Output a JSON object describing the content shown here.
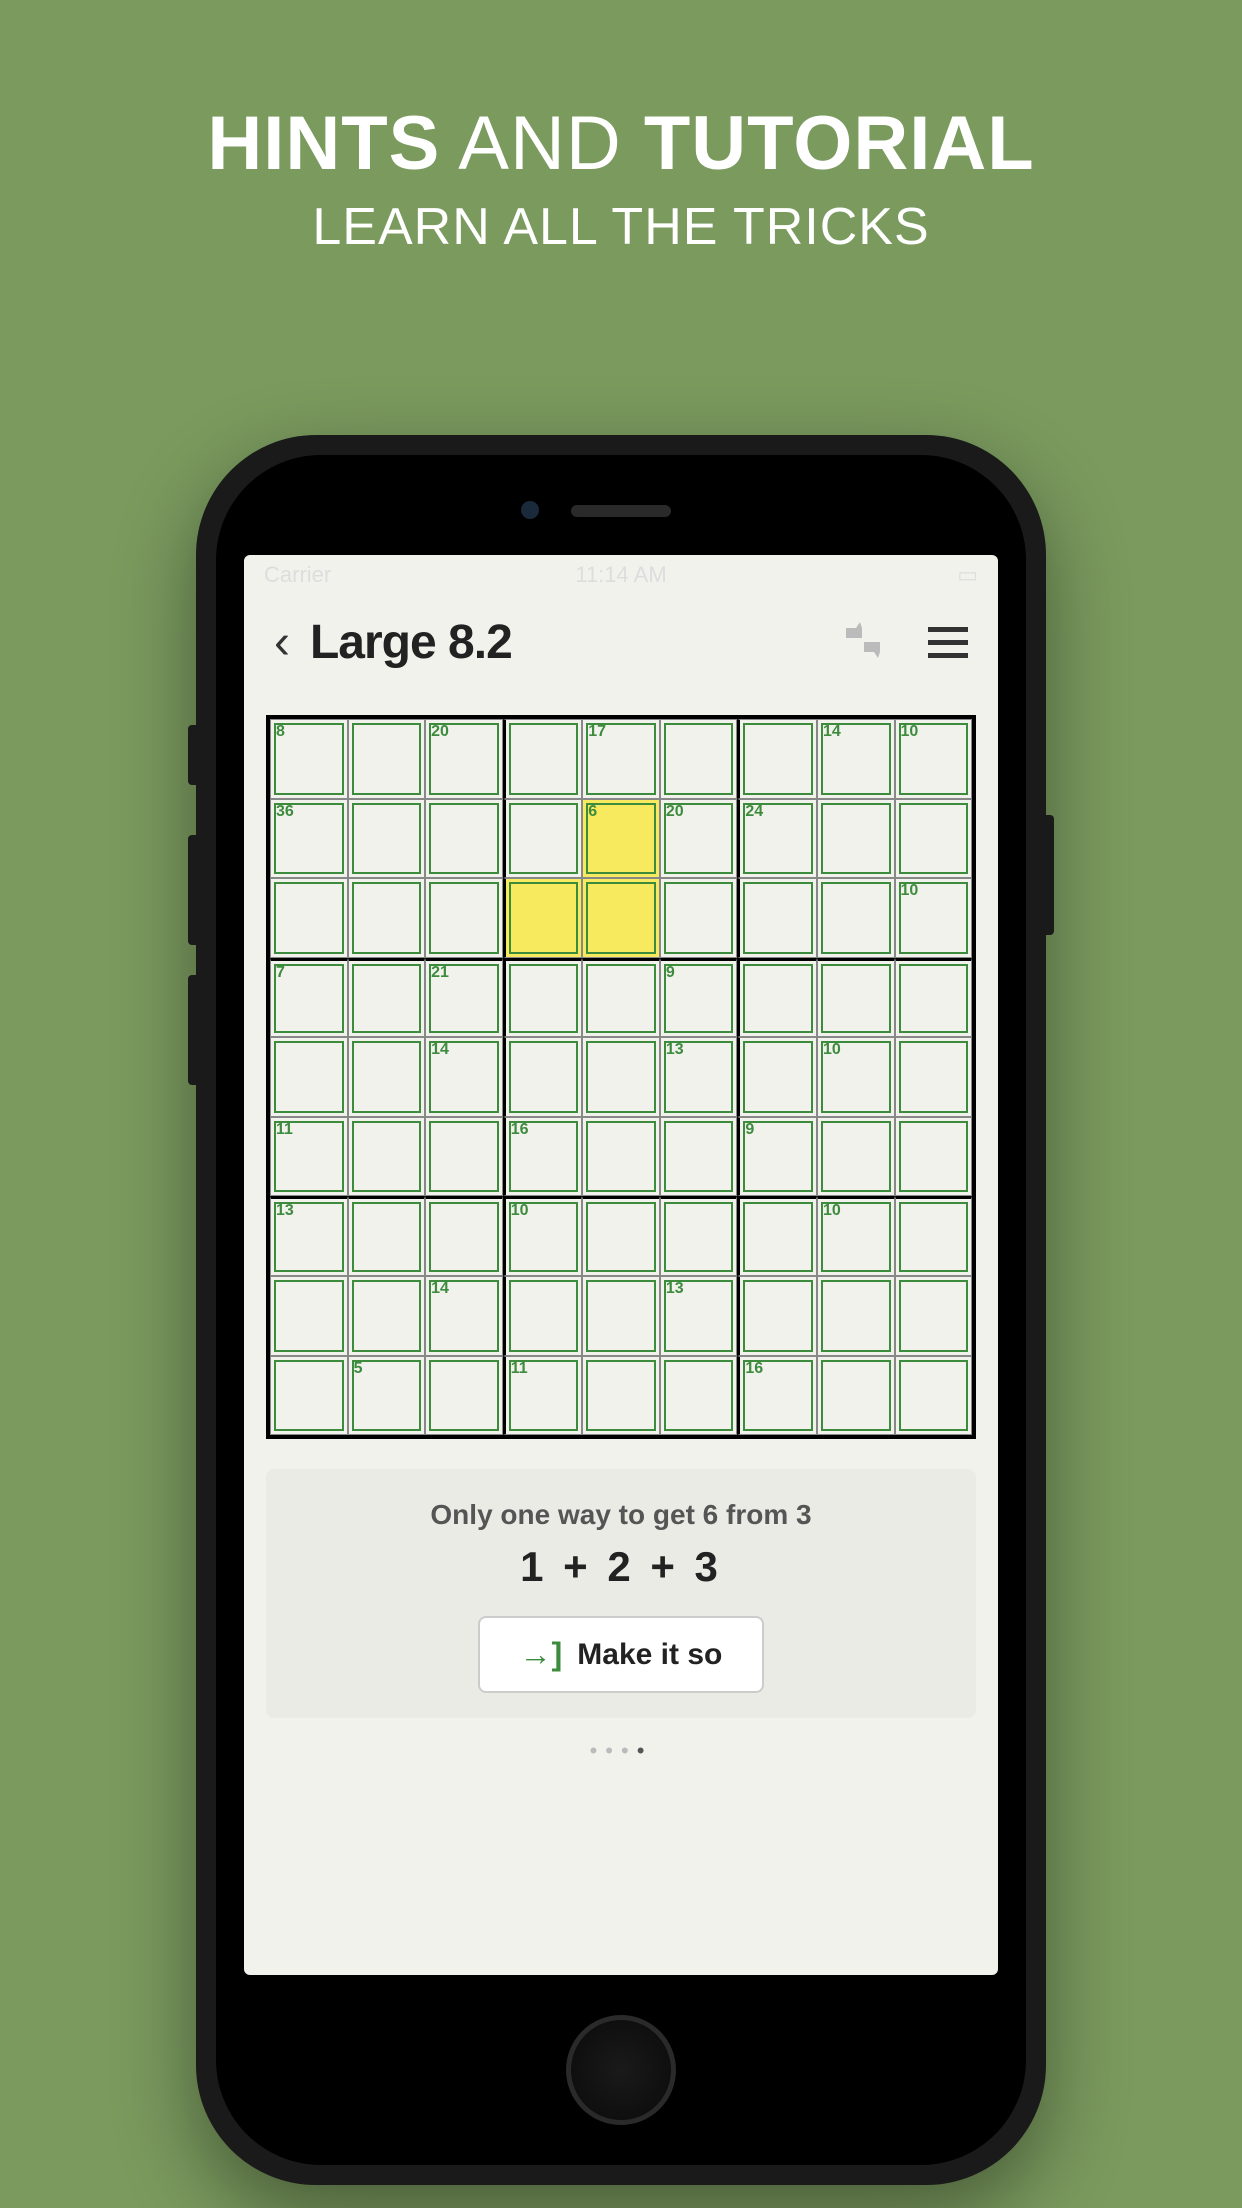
{
  "promo": {
    "title_b1": "HINTS",
    "title_mid": " AND ",
    "title_b2": "TUTORIAL",
    "subtitle": "LEARN ALL THE TRICKS"
  },
  "status": {
    "carrier": "Carrier",
    "time": "11:14 AM"
  },
  "nav": {
    "title": "Large 8.2"
  },
  "cages": {
    "r0c0": "8",
    "r0c2": "20",
    "r0c4": "17",
    "r0c7": "14",
    "r0c8": "10",
    "r1c0": "36",
    "r1c4": "6",
    "r1c5": "20",
    "r1c6": "24",
    "r2c8": "10",
    "r3c0": "7",
    "r3c2": "21",
    "r3c5": "9",
    "r4c2": "14",
    "r4c5": "13",
    "r4c7": "10",
    "r5c0": "11",
    "r5c3": "16",
    "r5c6": "9",
    "r6c0": "13",
    "r6c3": "10",
    "r6c7": "10",
    "r7c2": "14",
    "r7c5": "13",
    "r8c1": "5",
    "r8c3": "11",
    "r8c6": "16"
  },
  "highlights": [
    "r1c4",
    "r2c3",
    "r2c4"
  ],
  "hint": {
    "line1": "Only one way to get 6 from 3",
    "line2": "1 + 2 + 3",
    "button": "Make it so"
  },
  "pagination": {
    "count": 4,
    "active": 3
  }
}
